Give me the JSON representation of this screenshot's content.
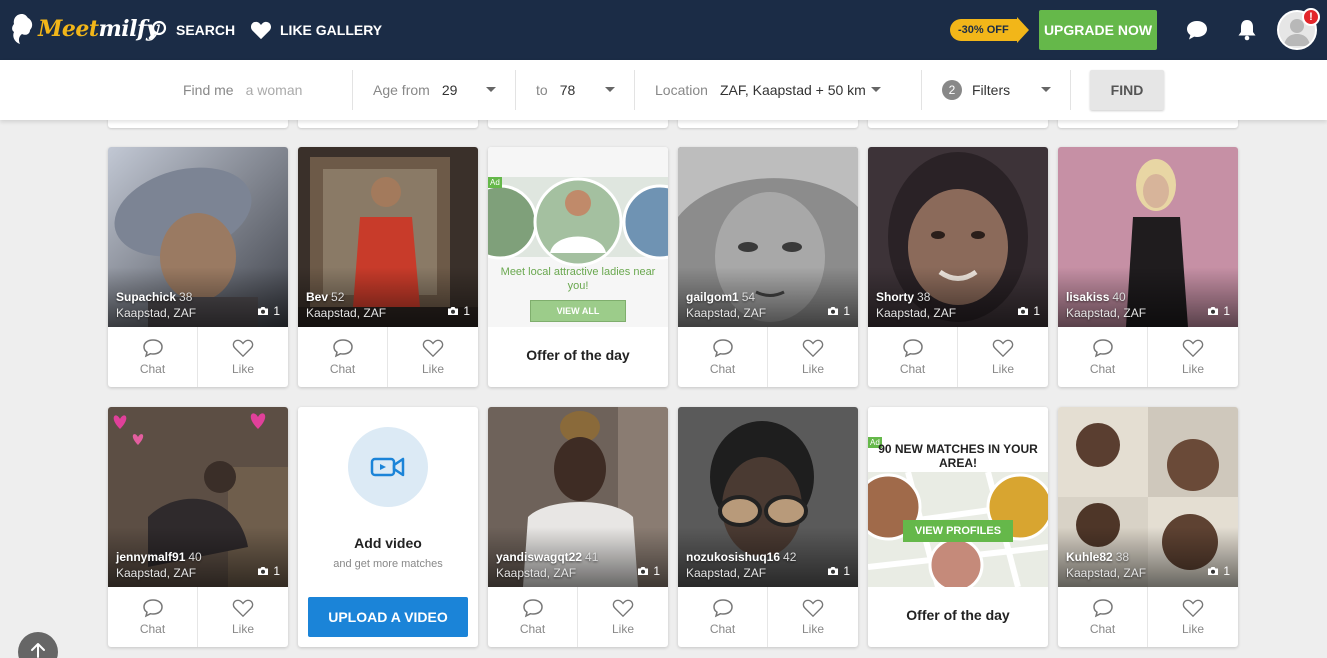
{
  "nav": {
    "brand_a": "Meet",
    "brand_b": "milfy",
    "search_label": "SEARCH",
    "gallery_label": "LIKE GALLERY",
    "discount": "-30% OFF",
    "upgrade_label": "UPGRADE NOW",
    "notification_badge": "!"
  },
  "search": {
    "find_label": "Find me",
    "find_value": "a woman",
    "age_label": "Age from",
    "age_from": "29",
    "to_label": "to",
    "age_to": "78",
    "location_label": "Location",
    "location_value": "ZAF, Kaapstad + 50 km",
    "filter_count": "2",
    "filters_label": "Filters",
    "find_button": "FIND"
  },
  "labels": {
    "chat": "Chat",
    "like": "Like"
  },
  "profiles": [
    {
      "name": "Supachick",
      "age": "38",
      "location": "Kaapstad, ZAF",
      "photos": "1",
      "colors": [
        "#8a7a6e",
        "#4a4d55"
      ]
    },
    {
      "name": "Bev",
      "age": "52",
      "location": "Kaapstad, ZAF",
      "photos": "1",
      "colors": [
        "#6e5844",
        "#2f2a28"
      ]
    },
    {
      "name": "gailgom1",
      "age": "54",
      "location": "Kaapstad, ZAF",
      "photos": "1",
      "colors": [
        "#b5b5b5",
        "#4a4a4a"
      ]
    },
    {
      "name": "Shorty",
      "age": "38",
      "location": "Kaapstad, ZAF",
      "photos": "1",
      "colors": [
        "#5a4a52",
        "#2a2026"
      ]
    },
    {
      "name": "lisakiss",
      "age": "40",
      "location": "Kaapstad, ZAF",
      "photos": "1",
      "colors": [
        "#c98aa3",
        "#2a2224"
      ]
    },
    {
      "name": "jennymalf91",
      "age": "40",
      "location": "Kaapstad, ZAF",
      "photos": "1",
      "colors": [
        "#6a5a4a",
        "#2c2522"
      ]
    },
    {
      "name": "yandiswagqt22",
      "age": "41",
      "location": "Kaapstad, ZAF",
      "photos": "1",
      "colors": [
        "#7a6a62",
        "#3a3230"
      ]
    },
    {
      "name": "nozukosishuq16",
      "age": "42",
      "location": "Kaapstad, ZAF",
      "photos": "1",
      "colors": [
        "#6a6a6a",
        "#222222"
      ]
    },
    {
      "name": "Kuhle82",
      "age": "38",
      "location": "Kaapstad, ZAF",
      "photos": "1",
      "colors": [
        "#d8d2c6",
        "#5a4a3e"
      ]
    }
  ],
  "ad1": {
    "tag": "Ad",
    "text": "Meet local attractive ladies near you!",
    "button": "VIEW ALL",
    "title": "Offer of the day"
  },
  "ad2": {
    "tag": "Ad",
    "headline": "90 NEW MATCHES IN YOUR AREA!",
    "button": "VIEW PROFILES",
    "title": "Offer of the day"
  },
  "video": {
    "title": "Add video",
    "subtitle": "and get more matches",
    "button": "UPLOAD A VIDEO"
  },
  "colors": {
    "navbar": "#1b2c46",
    "upgrade": "#65b84a",
    "discount": "#f2b619",
    "upload": "#1b84d8",
    "badge": "#e3262b"
  },
  "icons": {
    "search": "search-icon",
    "heart": "heart-icon",
    "chat": "chat-icon",
    "bell": "bell-icon",
    "camera": "camera-icon",
    "video": "video-camera-icon",
    "arrow_up": "arrow-up-icon"
  }
}
